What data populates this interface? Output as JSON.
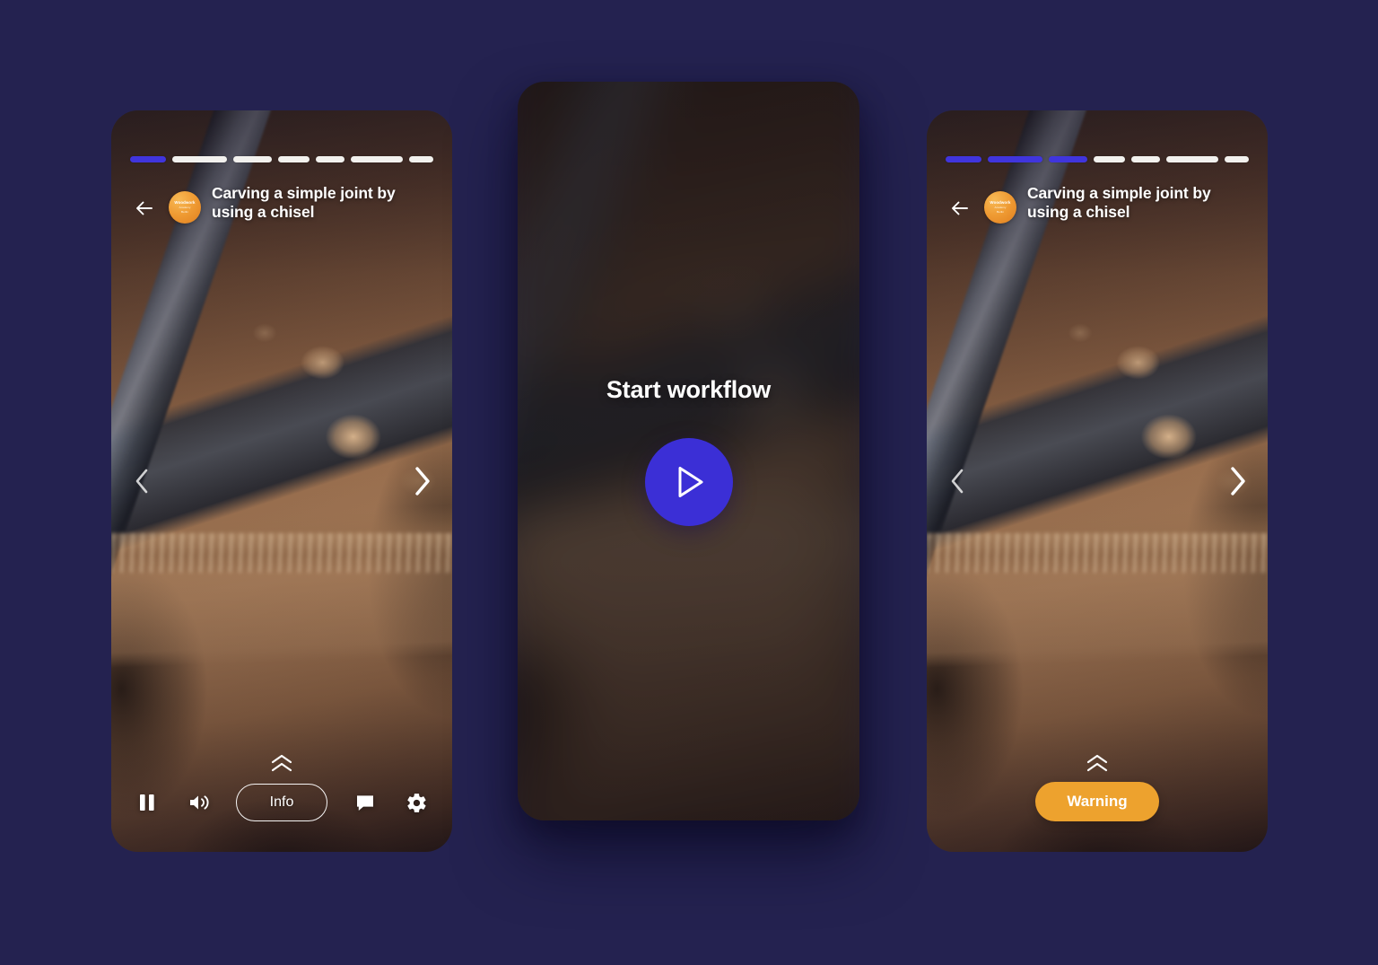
{
  "theme": {
    "page_background": "#242250",
    "progress_filled": "#4035dd",
    "progress_empty": "#f2f1ee",
    "play_button": "#3b2fd6",
    "warning_button": "#eda22e",
    "avatar_background": "#ef9b33",
    "text_primary": "#ffffff"
  },
  "brand": {
    "name": "Woodwork",
    "line2": "Academy",
    "line3": "Berlin"
  },
  "screens": [
    {
      "id": "player-info",
      "title": "Carving a simple joint by using a chisel",
      "progress": {
        "total_steps": 7,
        "current_step": 1,
        "segment_weights": [
          18,
          27,
          19,
          16,
          14,
          26,
          12
        ]
      },
      "back_label": "Back",
      "nav": {
        "prev": "Previous step",
        "next": "Next step"
      },
      "expand_label": "Expand details",
      "controls": [
        {
          "name": "pause",
          "label": "Pause"
        },
        {
          "name": "volume",
          "label": "Volume"
        },
        {
          "name": "info",
          "label": "Info"
        },
        {
          "name": "chat",
          "label": "Chat"
        },
        {
          "name": "settings",
          "label": "Settings"
        }
      ]
    },
    {
      "id": "start-workflow",
      "heading": "Start workflow",
      "play_label": "Play"
    },
    {
      "id": "player-warning",
      "title": "Carving a simple joint by using a chisel",
      "progress": {
        "total_steps": 7,
        "current_step": 3,
        "segment_weights": [
          18,
          27,
          19,
          16,
          14,
          26,
          12
        ]
      },
      "back_label": "Back",
      "nav": {
        "prev": "Previous step",
        "next": "Next step"
      },
      "expand_label": "Expand details",
      "warning_label": "Warning"
    }
  ]
}
